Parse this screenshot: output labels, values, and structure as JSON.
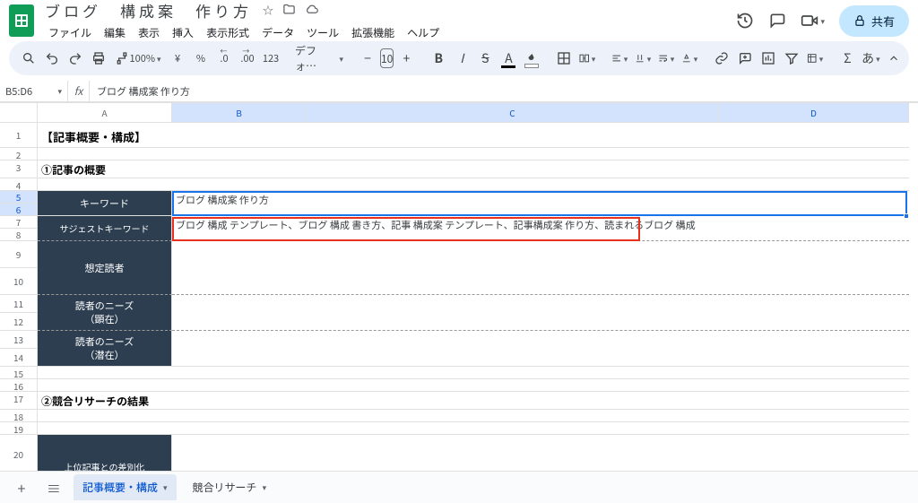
{
  "doc": {
    "title": "ブログ　構成案　作り方"
  },
  "menus": {
    "file": "ファイル",
    "edit": "編集",
    "view": "表示",
    "insert": "挿入",
    "format": "表示形式",
    "data": "データ",
    "tools": "ツール",
    "extensions": "拡張機能",
    "help": "ヘルプ"
  },
  "share": {
    "label": "共有"
  },
  "toolbar": {
    "zoom": "100%",
    "currency": "¥",
    "percent": "%",
    "dec_dec": ".0",
    "dec_inc": ".00",
    "numfmt": "123",
    "font_family": "デフォ…",
    "font_size": "10",
    "bold": "B",
    "italic": "I",
    "strike": "S",
    "underline": "A",
    "sigma": "Σ",
    "jp": "あ"
  },
  "namebox": {
    "ref": "B5:D6"
  },
  "formula": {
    "text": "ブログ 構成案 作り方"
  },
  "columns": {
    "A": "A",
    "B": "B",
    "C": "C",
    "D": "D"
  },
  "rows": [
    "1",
    "2",
    "3",
    "4",
    "5",
    "6",
    "7",
    "8",
    "9",
    "10",
    "11",
    "12",
    "13",
    "14",
    "15",
    "16",
    "17",
    "18",
    "19",
    "20"
  ],
  "cells": {
    "r1": "【記事概要・構成】",
    "r3": "①記事の概要",
    "keyword_label": "キーワード",
    "keyword_value": "ブログ 構成案 作り方",
    "suggest_label": "サジェストキーワード",
    "suggest_value": "ブログ 構成 テンプレート、ブログ 構成 書き方、記事 構成案 テンプレート、記事構成案 作り方、読まれるブログ 構成",
    "reader_label": "想定読者",
    "needs1a": "読者のニーズ",
    "needs1b": "（顕在）",
    "needs2a": "読者のニーズ",
    "needs2b": "（潜在）",
    "r17": "②競合リサーチの結果",
    "r20": "上位記事との差別化"
  },
  "tabs": {
    "active": "記事概要・構成",
    "second": "競合リサーチ"
  }
}
